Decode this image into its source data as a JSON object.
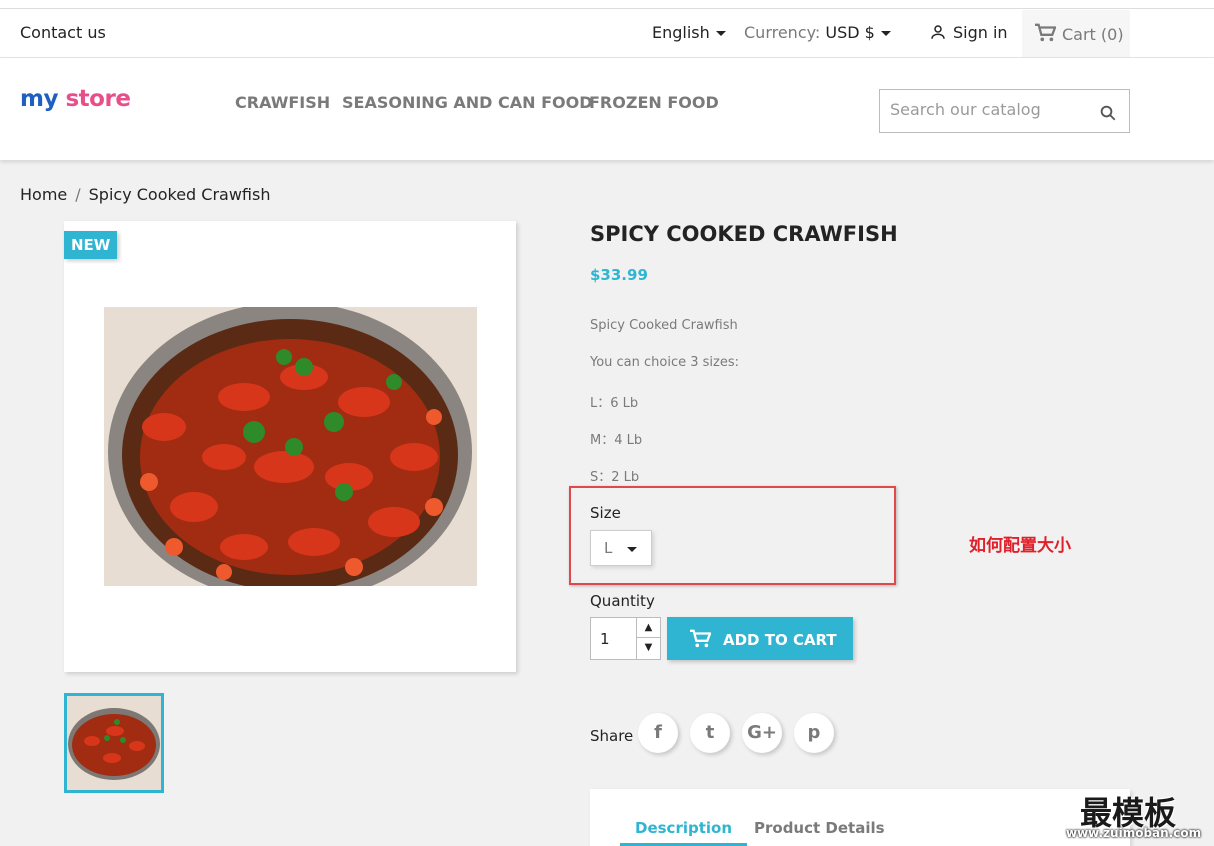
{
  "topbar": {
    "contact": "Contact us",
    "language": "English",
    "currency_label": "Currency:",
    "currency_value": "USD $",
    "signin": "Sign in",
    "cart": "Cart (0)"
  },
  "header": {
    "logo_words": [
      "my",
      "store"
    ],
    "nav": [
      "CRAWFISH",
      "SEASONING AND CAN FOOD",
      "FROZEN FOOD"
    ],
    "search_placeholder": "Search our catalog"
  },
  "breadcrumb": [
    "Home",
    "Spicy Cooked Crawfish"
  ],
  "product": {
    "badge": "NEW",
    "title": "SPICY COOKED CRAWFISH",
    "price": "$33.99",
    "description": [
      "Spicy Cooked Crawfish",
      "You can choice 3 sizes:",
      "L：6 Lb",
      "M：4 Lb",
      "S：2 Lb"
    ],
    "size_label": "Size",
    "size_value": "L",
    "quantity_label": "Quantity",
    "quantity_value": "1",
    "add_to_cart": "ADD TO CART",
    "share_label": "Share",
    "social": [
      "f",
      "t",
      "G+",
      "p"
    ],
    "tabs": [
      "Description",
      "Product Details"
    ]
  },
  "annotation": "如何配置大小",
  "watermark": {
    "big": "最模板",
    "small": "www.zuimoban.com"
  },
  "colors": {
    "accent": "#2fb5d2",
    "annotation": "#e0202a",
    "background": "#f1f1f1"
  }
}
